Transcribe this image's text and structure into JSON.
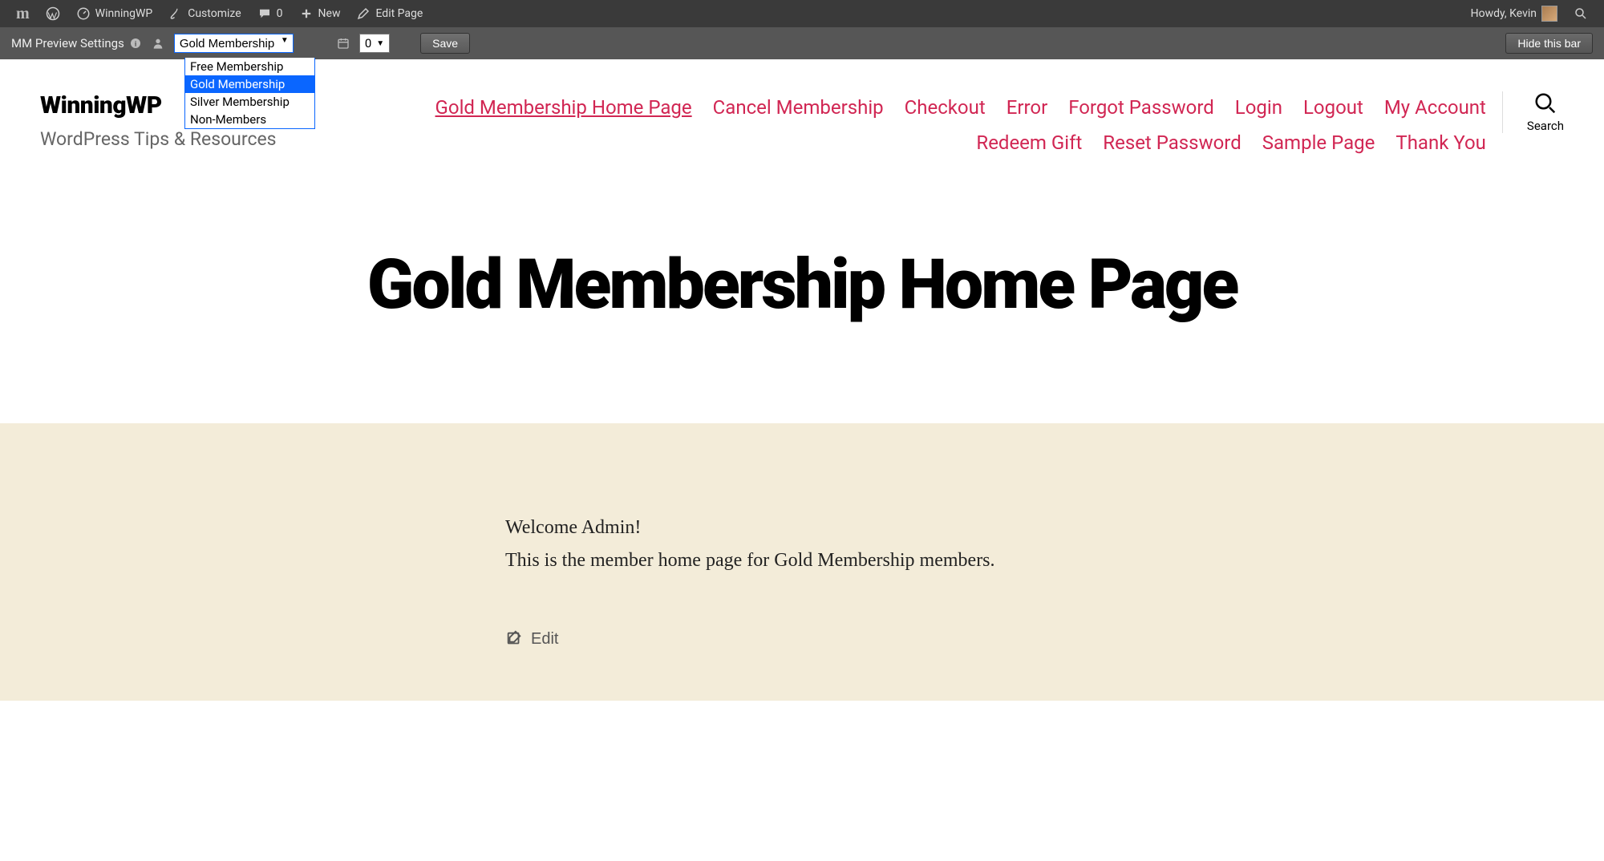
{
  "wp_bar": {
    "site_name": "WinningWP",
    "customize": "Customize",
    "comments_count": "0",
    "new": "New",
    "edit_page": "Edit Page",
    "greeting": "Howdy, Kevin"
  },
  "mm_bar": {
    "label": "MM Preview Settings",
    "membership_selected": "Gold Membership",
    "membership_options": [
      "Free Membership",
      "Gold Membership",
      "Silver Membership",
      "Non-Members"
    ],
    "days_value": "0",
    "save": "Save",
    "hide": "Hide this bar"
  },
  "brand": {
    "title": "WinningWP",
    "tagline": "WordPress Tips & Resources"
  },
  "nav": {
    "items": [
      {
        "label": "Gold Membership Home Page",
        "active": true
      },
      {
        "label": "Cancel Membership",
        "active": false
      },
      {
        "label": "Checkout",
        "active": false
      },
      {
        "label": "Error",
        "active": false
      },
      {
        "label": "Forgot Password",
        "active": false
      },
      {
        "label": "Login",
        "active": false
      },
      {
        "label": "Logout",
        "active": false
      },
      {
        "label": "My Account",
        "active": false
      },
      {
        "label": "Redeem Gift",
        "active": false
      },
      {
        "label": "Reset Password",
        "active": false
      },
      {
        "label": "Sample Page",
        "active": false
      },
      {
        "label": "Thank You",
        "active": false
      }
    ],
    "search_label": "Search"
  },
  "hero": {
    "title": "Gold Membership Home Page"
  },
  "content": {
    "line1": "Welcome Admin!",
    "line2": "This is the member home page for Gold Membership members.",
    "edit": "Edit"
  }
}
